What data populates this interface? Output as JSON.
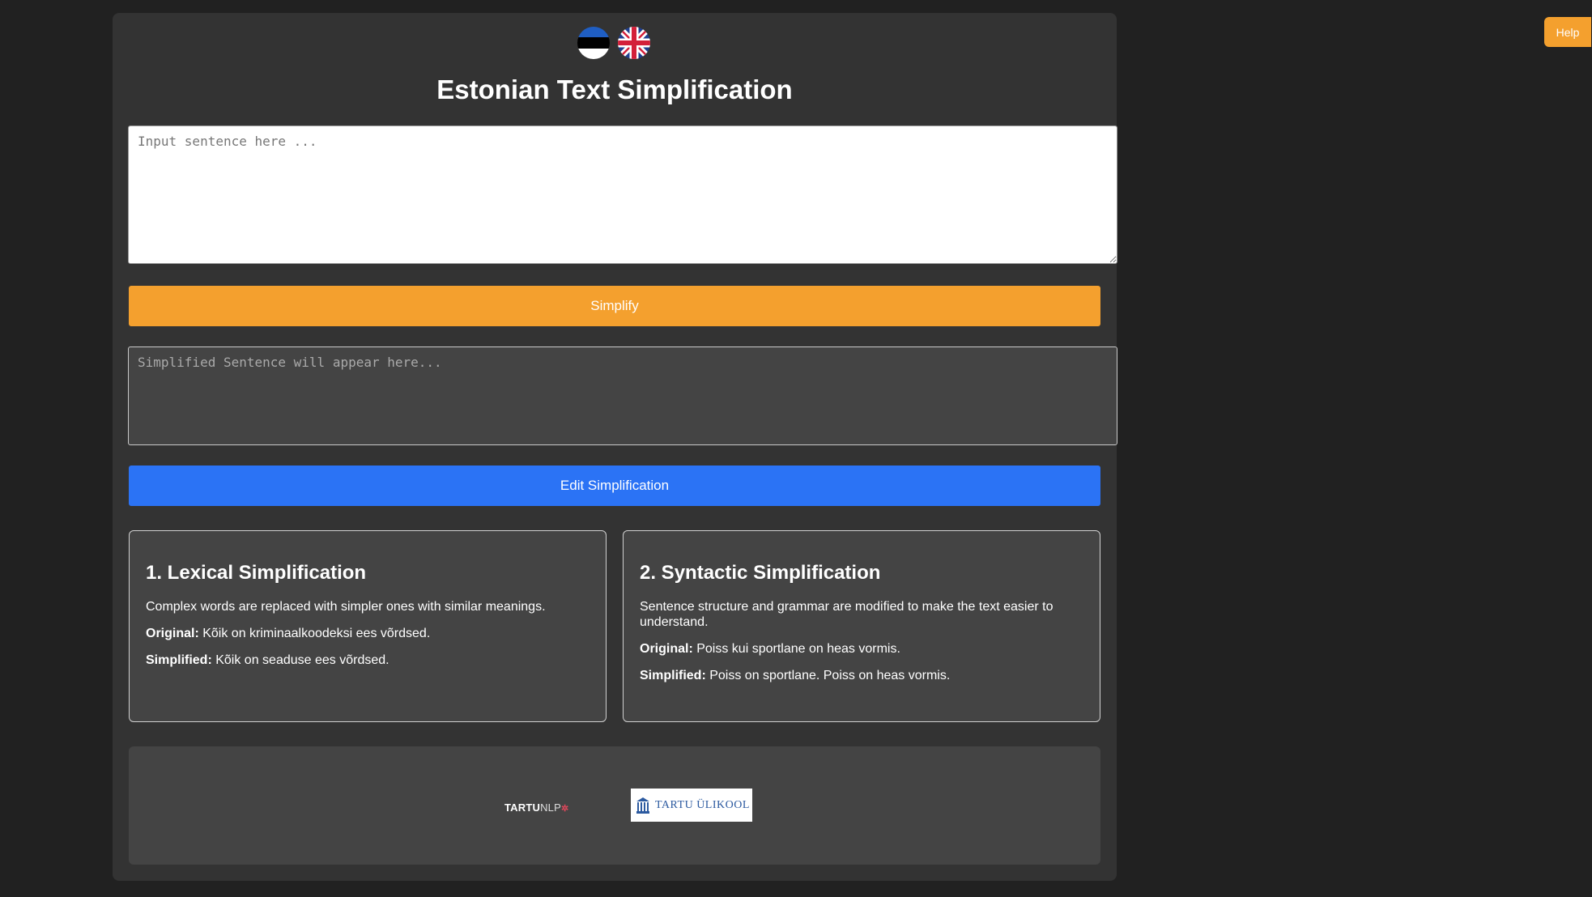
{
  "header": {
    "title": "Estonian Text Simplification",
    "languages": [
      {
        "name": "estonian-flag-icon"
      },
      {
        "name": "uk-flag-icon"
      }
    ]
  },
  "input": {
    "placeholder": "Input sentence here ...",
    "value": ""
  },
  "actions": {
    "simplify_label": "Simplify",
    "edit_label": "Edit Simplification",
    "help_label": "Help"
  },
  "output": {
    "placeholder": "Simplified Sentence will appear here...",
    "value": ""
  },
  "cards": [
    {
      "title": "1. Lexical Simplification",
      "description": "Complex words are replaced with simpler ones with similar meanings.",
      "original_label": "Original:",
      "original": "Kõik on kriminaalkoodeksi ees võrdsed.",
      "simplified_label": "Simplified:",
      "simplified": "Kõik on seaduse ees võrdsed."
    },
    {
      "title": "2. Syntactic Simplification",
      "description": "Sentence structure and grammar are modified to make the text easier to understand.",
      "original_label": "Original:",
      "original": "Poiss kui sportlane on heas vormis.",
      "simplified_label": "Simplified:",
      "simplified": "Poiss on sportlane. Poiss on heas vormis."
    }
  ],
  "footer": {
    "logo_tartunlp_main": "TARTU",
    "logo_tartunlp_nlp": "NLP",
    "logo_ut": "TARTU ÜLIKOOL"
  },
  "colors": {
    "background": "#212121",
    "panel": "#333333",
    "accent_orange": "#f4a02e",
    "accent_blue": "#2b73f5"
  }
}
